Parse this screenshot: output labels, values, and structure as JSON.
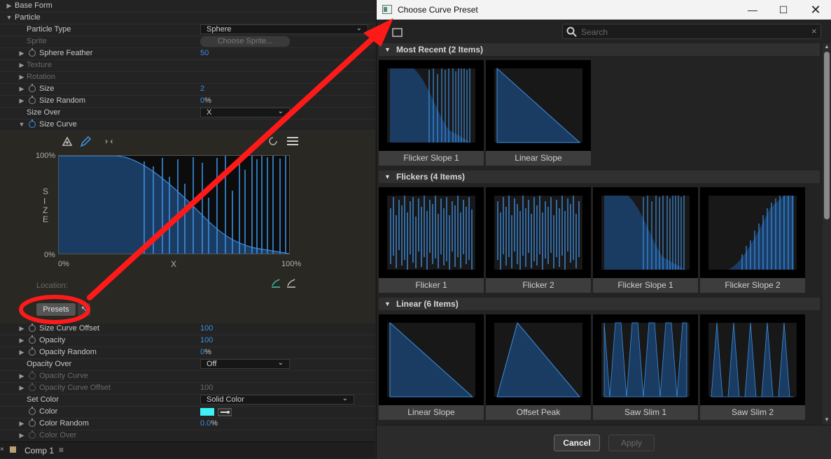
{
  "left_panel": {
    "rows": {
      "base_form": "Base Form",
      "particle": "Particle",
      "particle_type": {
        "label": "Particle Type",
        "value": "Sphere"
      },
      "sprite": {
        "label": "Sprite",
        "button": "Choose Sprite..."
      },
      "sphere_feather": {
        "label": "Sphere Feather",
        "value": "50"
      },
      "texture": "Texture",
      "rotation": "Rotation",
      "size": {
        "label": "Size",
        "value": "2"
      },
      "size_random": {
        "label": "Size Random",
        "value": "0",
        "unit": "%"
      },
      "size_over": {
        "label": "Size Over",
        "value": "X"
      },
      "size_curve": "Size Curve",
      "size_curve_offset": {
        "label": "Size Curve Offset",
        "value": "100"
      },
      "opacity": {
        "label": "Opacity",
        "value": "100"
      },
      "opacity_random": {
        "label": "Opacity Random",
        "value": "0",
        "unit": "%"
      },
      "opacity_over": {
        "label": "Opacity Over",
        "value": "Off"
      },
      "opacity_curve": "Opacity Curve",
      "opacity_curve_offset": {
        "label": "Opacity Curve Offset",
        "value": "100"
      },
      "set_color": {
        "label": "Set Color",
        "value": "Solid Color"
      },
      "color": {
        "label": "Color",
        "swatch": "#3ff0f5"
      },
      "color_random": {
        "label": "Color Random",
        "value": "0.0",
        "unit": "%"
      },
      "color_over": "Color Over"
    },
    "graph": {
      "y_top": "100%",
      "y_bottom": "0%",
      "y_axis_letters": [
        "S",
        "I",
        "Z",
        "E"
      ],
      "x_left": "0%",
      "x_mid": "X",
      "x_right": "100%"
    },
    "curve_tools": {
      "reset_glyph": "› ‹"
    },
    "location_label": "Location:",
    "presets_button": "Presets",
    "timeline_tab": "Comp 1"
  },
  "dialog": {
    "title": "Choose Curve Preset",
    "search_placeholder": "Search",
    "sections": [
      {
        "title": "Most Recent (2 Items)",
        "items": [
          "Flicker Slope 1",
          "Linear Slope"
        ]
      },
      {
        "title": "Flickers (4 Items)",
        "items": [
          "Flicker 1",
          "Flicker 2",
          "Flicker Slope 1",
          "Flicker Slope 2"
        ]
      },
      {
        "title": "Linear (6 Items)",
        "items": [
          "Linear Slope",
          "Offset Peak",
          "Saw Slim 1",
          "Saw Slim 2"
        ]
      }
    ],
    "cancel_label": "Cancel",
    "apply_label": "Apply"
  },
  "colors": {
    "accent_blue": "#3d8fe0",
    "curve_fill": "#1a3c63",
    "annotation_red": "#ff1a1a"
  }
}
